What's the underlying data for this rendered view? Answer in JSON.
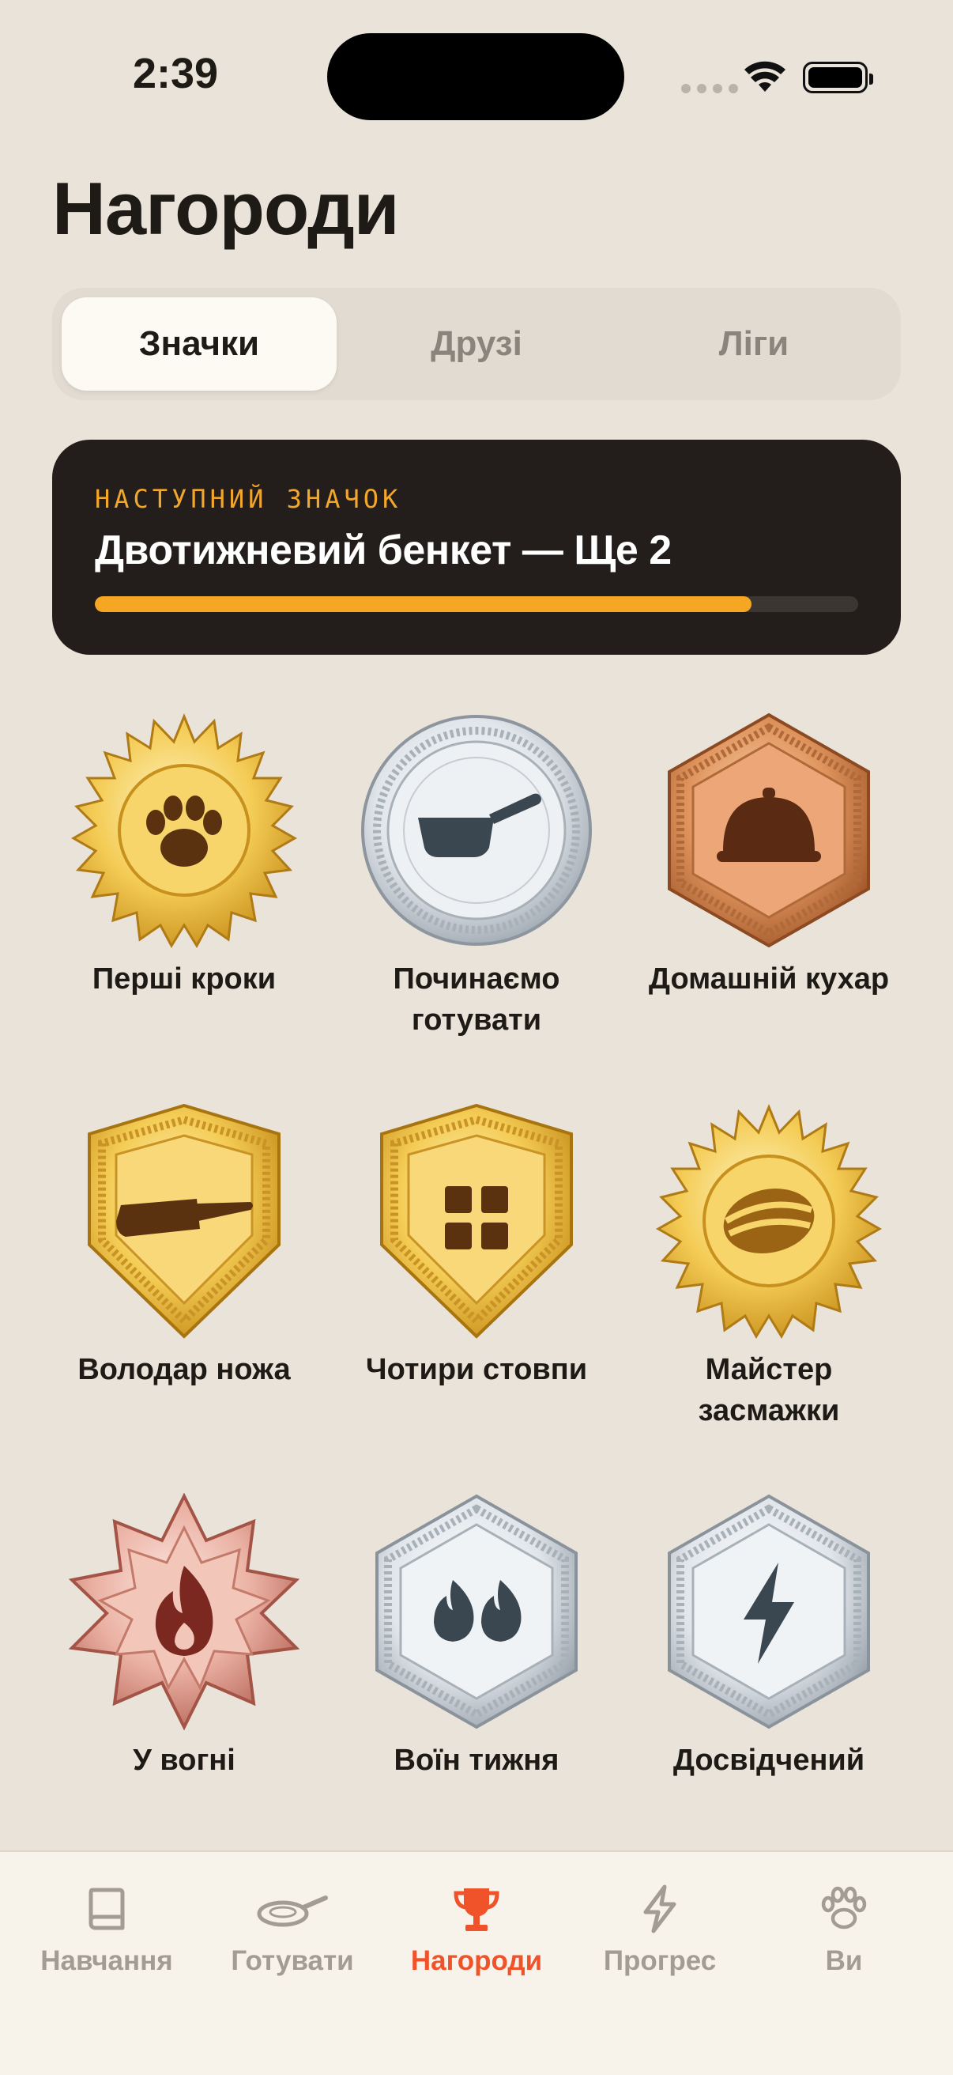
{
  "status_bar": {
    "time": "2:39"
  },
  "page": {
    "title": "Нагороди"
  },
  "segments": [
    {
      "label": "Значки",
      "active": true
    },
    {
      "label": "Друзі",
      "active": false
    },
    {
      "label": "Ліги",
      "active": false
    }
  ],
  "next_badge": {
    "label": "НАСТУПНИЙ ЗНАЧОК",
    "name": "Двотижневий бенкет — Ще 2",
    "progress": 0.86
  },
  "badges": [
    {
      "label": "Перші кроки",
      "icon": "paw-icon",
      "tier": "gold",
      "shape": "burst"
    },
    {
      "label": "Починаємо готувати",
      "icon": "saucepan-icon",
      "tier": "silver",
      "shape": "coin"
    },
    {
      "label": "Домашній кухар",
      "icon": "cloche-icon",
      "tier": "bronze",
      "shape": "hexagon"
    },
    {
      "label": "Володар ножа",
      "icon": "knife-icon",
      "tier": "gold",
      "shape": "shield"
    },
    {
      "label": "Чотири стовпи",
      "icon": "grid-icon",
      "tier": "gold",
      "shape": "shield"
    },
    {
      "label": "Майстер засмажки",
      "icon": "sear-icon",
      "tier": "gold",
      "shape": "burst"
    },
    {
      "label": "У вогні",
      "icon": "flame-icon",
      "tier": "rose",
      "shape": "star"
    },
    {
      "label": "Воїн тижня",
      "icon": "double-flame-icon",
      "tier": "silver",
      "shape": "hexagon"
    },
    {
      "label": "Досвідчений",
      "icon": "lightning-icon",
      "tier": "silver",
      "shape": "hexagon"
    }
  ],
  "tab_bar": [
    {
      "label": "Навчання",
      "icon": "book-icon",
      "active": false
    },
    {
      "label": "Готувати",
      "icon": "pan-icon",
      "active": false
    },
    {
      "label": "Нагороди",
      "icon": "trophy-icon",
      "active": true
    },
    {
      "label": "Прогрес",
      "icon": "lightning-icon",
      "active": false
    },
    {
      "label": "Ви",
      "icon": "paw-icon",
      "active": false
    }
  ],
  "colors": {
    "accent": "#f0522a",
    "progress": "#f5a623",
    "background": "#e9e3da"
  }
}
